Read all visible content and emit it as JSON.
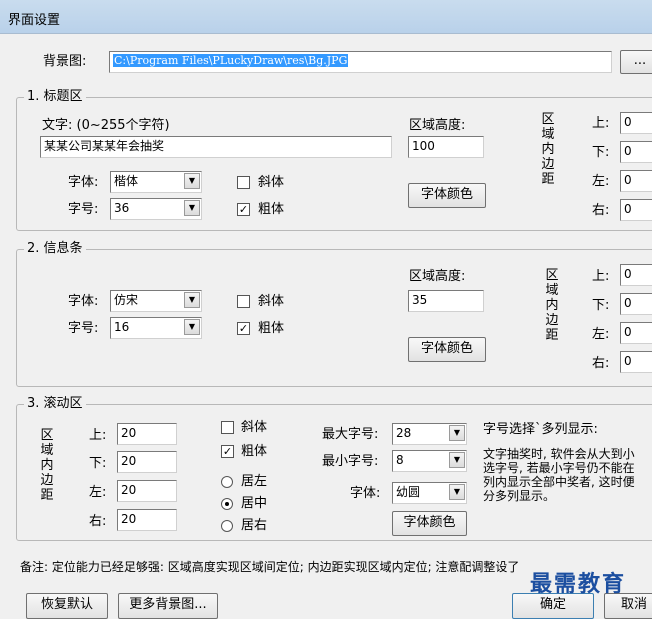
{
  "window": {
    "title": "界面设置"
  },
  "background": {
    "label": "背景图:",
    "path": "C:\\Program Files\\PLuckyDraw\\res\\Bg.JPG",
    "browse": "..."
  },
  "title_area": {
    "group": "1. 标题区",
    "text_label": "文字: (0~255个字符)",
    "text_value": "某某公司某某年会抽奖",
    "height_label": "区域高度:",
    "height_value": "100",
    "font_label": "字体:",
    "font_value": "楷体",
    "size_label": "字号:",
    "size_value": "36",
    "italic": "斜体",
    "italic_checked": false,
    "bold": "粗体",
    "bold_checked": true,
    "color_button": "字体颜色",
    "padding_label": "区域内边距",
    "padding": [
      {
        "label": "上:",
        "value": "0"
      },
      {
        "label": "下:",
        "value": "0"
      },
      {
        "label": "左:",
        "value": "0"
      },
      {
        "label": "右:",
        "value": "0"
      }
    ]
  },
  "info_bar": {
    "group": "2. 信息条",
    "height_label": "区域高度:",
    "height_value": "35",
    "font_label": "字体:",
    "font_value": "仿宋",
    "size_label": "字号:",
    "size_value": "16",
    "italic": "斜体",
    "italic_checked": false,
    "bold": "粗体",
    "bold_checked": true,
    "color_button": "字体颜色",
    "padding_label": "区域内边距",
    "padding": [
      {
        "label": "上:",
        "value": "0"
      },
      {
        "label": "下:",
        "value": "0"
      },
      {
        "label": "左:",
        "value": "0"
      },
      {
        "label": "右:",
        "value": "0"
      }
    ]
  },
  "scroll_area": {
    "group": "3. 滚动区",
    "padding_label": "区域内边距",
    "padding": [
      {
        "label": "上:",
        "value": "20"
      },
      {
        "label": "下:",
        "value": "20"
      },
      {
        "label": "左:",
        "value": "20"
      },
      {
        "label": "右:",
        "value": "20"
      }
    ],
    "italic": "斜体",
    "italic_checked": false,
    "bold": "粗体",
    "bold_checked": true,
    "align_left": "居左",
    "align_center": "居中",
    "align_right": "居右",
    "align_selected": "center",
    "max_size_label": "最大字号:",
    "max_size_value": "28",
    "min_size_label": "最小字号:",
    "min_size_value": "8",
    "font_label": "字体:",
    "font_value": "幼圆",
    "color_button": "字体颜色",
    "hint_line1": "字号选择`多列显示:",
    "hint_line2": "文字抽奖时, 软件会从大到小",
    "hint_line3": "选字号, 若最小字号仍不能在",
    "hint_line4": "列内显示全部中奖者, 这时便",
    "hint_line5": "分多列显示。"
  },
  "note": "备注: 定位能力已经足够强: 区域高度实现区域间定位; 内边距实现区域内定位; 注意配调整设了",
  "buttons": {
    "restore": "恢复默认",
    "more_bg": "更多背景图...",
    "ok": "确定",
    "cancel": "取消"
  },
  "watermark": "最需教育"
}
